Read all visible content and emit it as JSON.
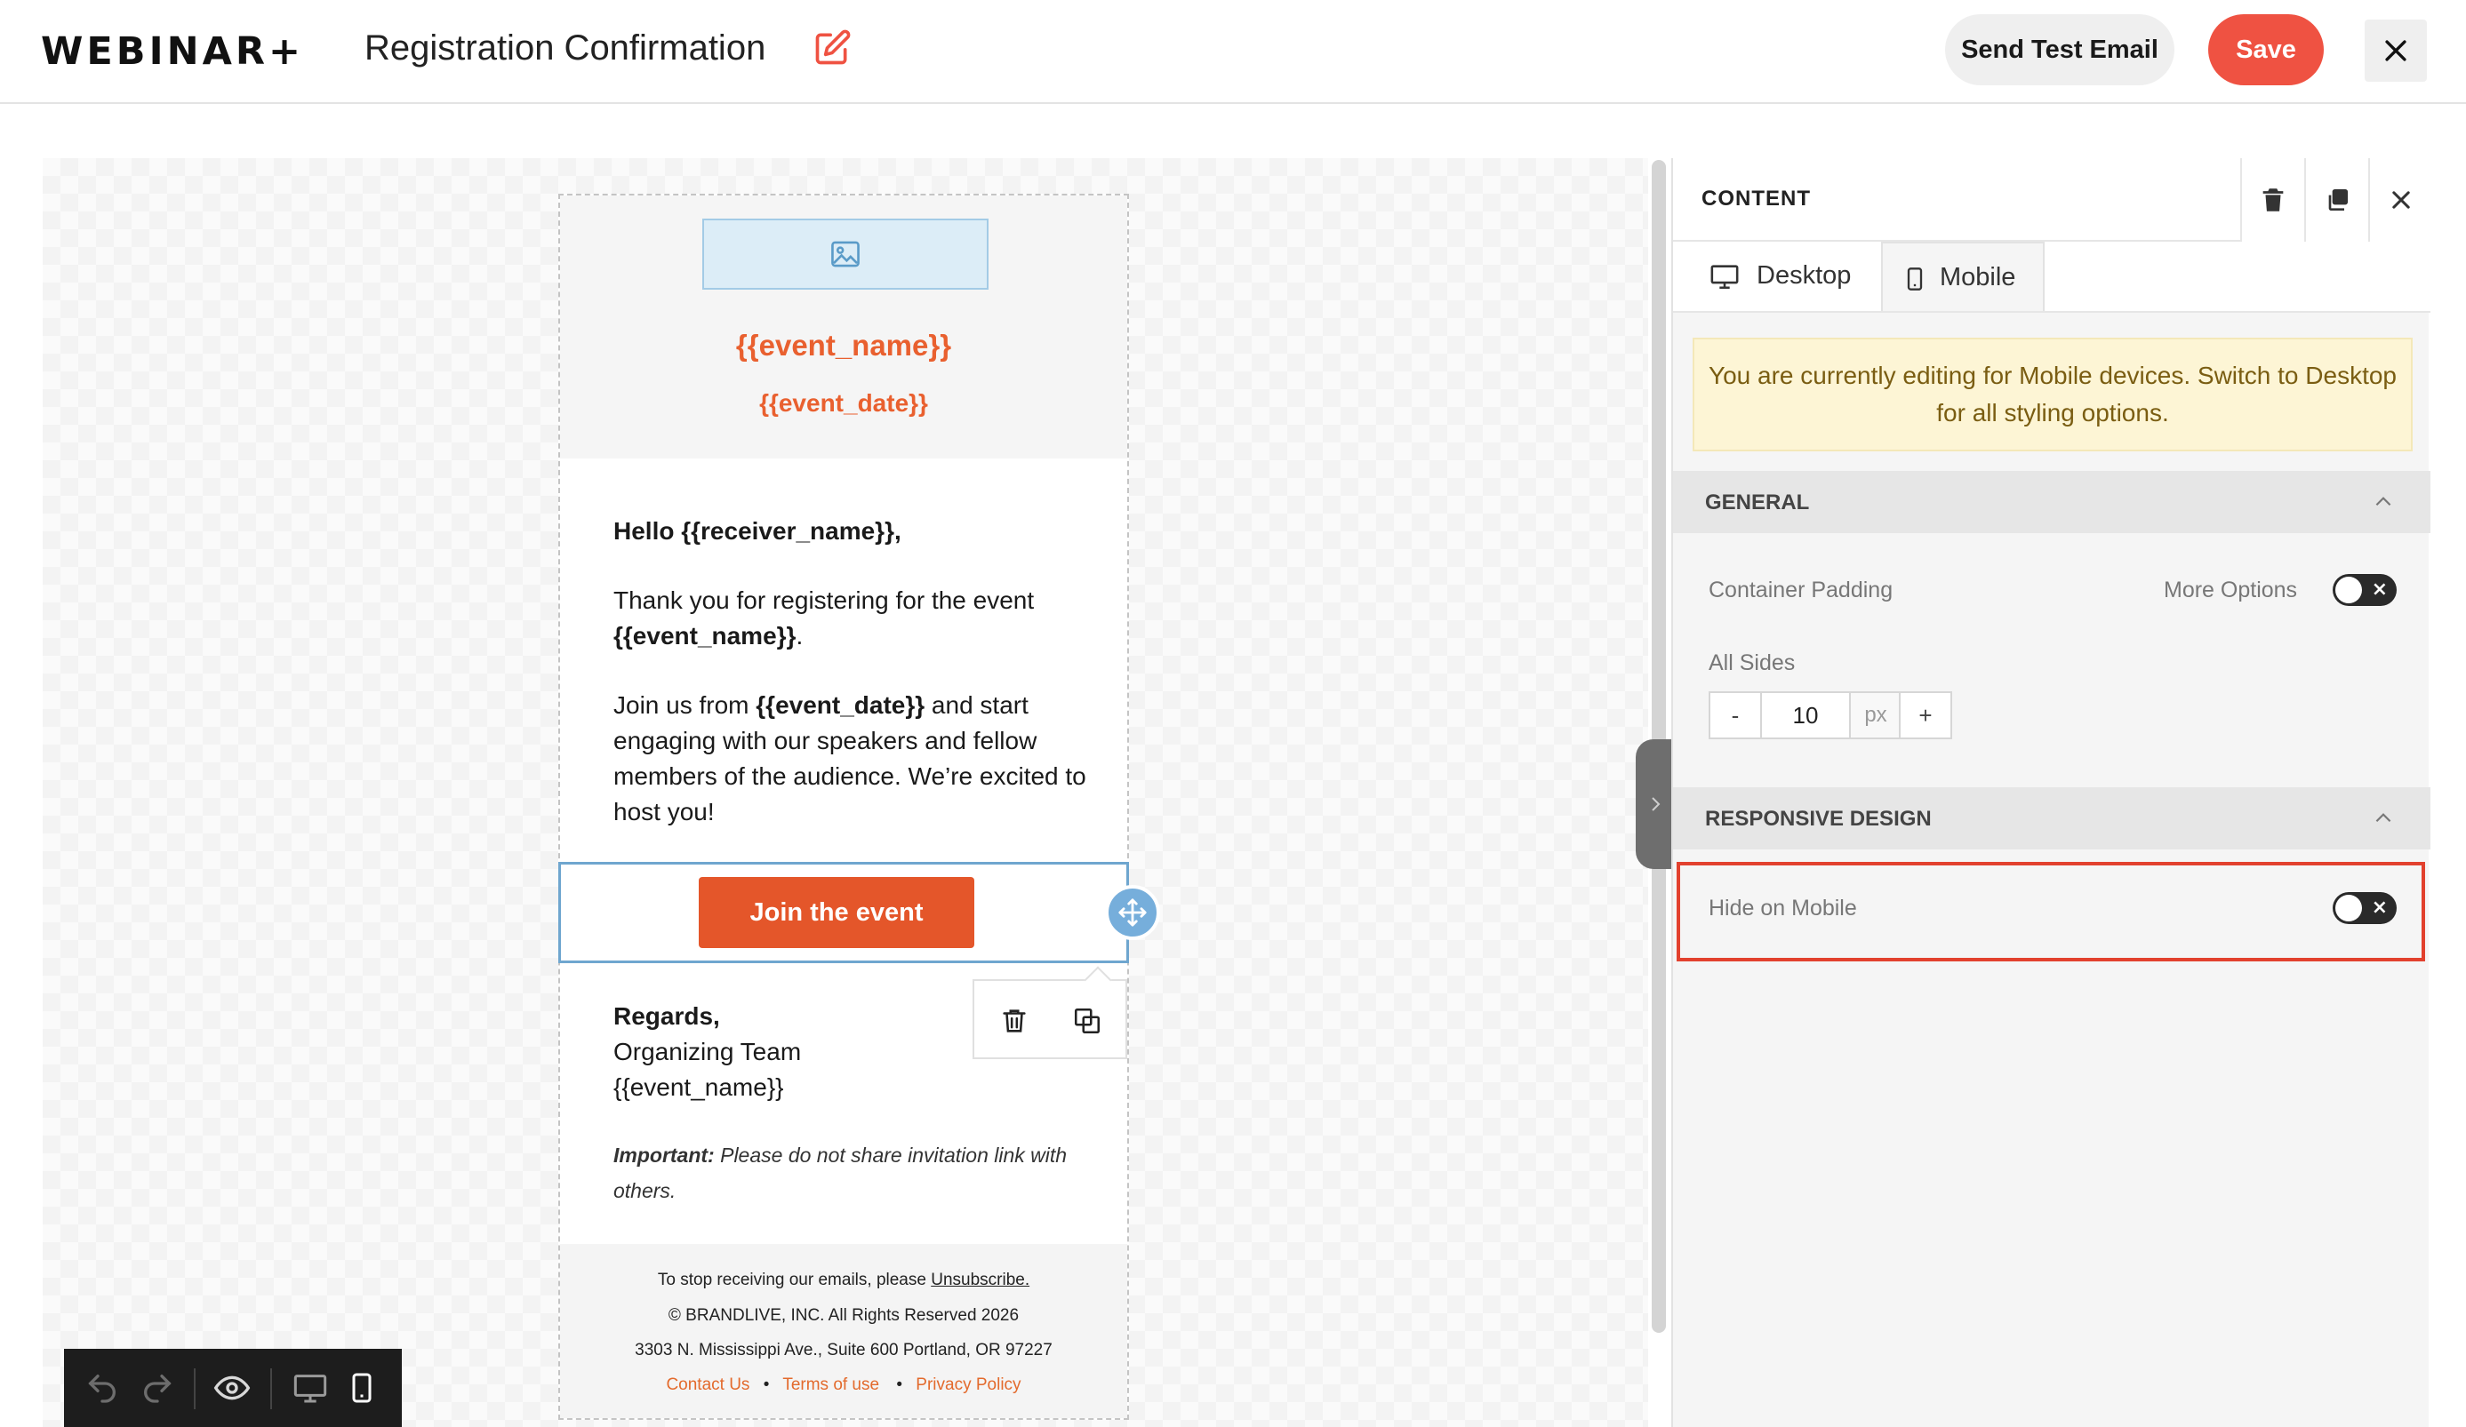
{
  "header": {
    "logo": "WEBINAR+",
    "title": "Registration Confirmation",
    "send_test_label": "Send Test Email",
    "save_label": "Save"
  },
  "email": {
    "event_name": "{{event_name}}",
    "event_date": "{{event_date}}",
    "greeting": "Hello {{receiver_name}},",
    "thanks_prefix": "Thank you for registering for the event",
    "thanks_event": "{{event_name}}",
    "thanks_suffix": ".",
    "join_prefix": "Join us from ",
    "join_date": "{{event_date}}",
    "join_suffix": " and start engaging with our speakers and fellow members of the audience. We’re excited to host you!",
    "button_label": "Join the event",
    "regards": "Regards,",
    "team": "Organizing Team",
    "sign_event": "{{event_name}}",
    "important_label": "Important:",
    "important_text": " Please do not share invitation link with others.",
    "footer": {
      "unsub_prefix": "To stop receiving our emails, please ",
      "unsub_link": "Unsubscribe.",
      "copyright": "© BRANDLIVE, INC. All Rights Reserved 2026",
      "address": "3303 N. Mississippi Ave., Suite 600 Portland, OR 97227",
      "links": [
        "Contact Us",
        "Terms of use",
        "Privacy Policy"
      ],
      "separator": "•"
    }
  },
  "panel": {
    "title": "CONTENT",
    "tabs": [
      {
        "label": "Desktop",
        "icon": "desktop-icon",
        "active": false
      },
      {
        "label": "Mobile",
        "icon": "mobile-icon",
        "active": true
      }
    ],
    "notice": "You are currently editing for Mobile devices. Switch to Desktop for all styling options.",
    "general": {
      "title": "GENERAL",
      "container_padding_label": "Container Padding",
      "more_options_label": "More Options",
      "all_sides_label": "All Sides",
      "padding_value": "10",
      "padding_unit": "px",
      "minus": "-",
      "plus": "+"
    },
    "responsive": {
      "title": "RESPONSIVE DESIGN",
      "hide_on_mobile_label": "Hide on Mobile"
    }
  },
  "colors": {
    "accent": "#ef5242",
    "event_orange": "#e9602f",
    "button_orange": "#e4562a",
    "selection_blue": "#6fa6cf",
    "highlight_red": "#e2412e",
    "notice_bg": "#fdf5d5"
  }
}
